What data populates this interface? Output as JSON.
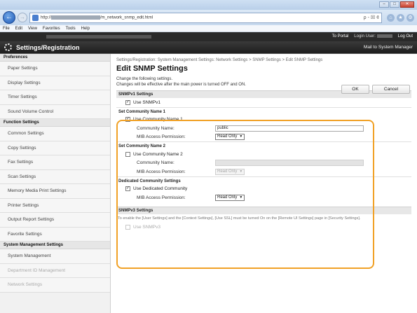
{
  "browser": {
    "url_prefix": "http://",
    "url_suffix": "/m_network_snmp_edit.html",
    "url_tools": "ρ - ☒ ¢",
    "menu": [
      "File",
      "Edit",
      "View",
      "Favorites",
      "Tools",
      "Help"
    ]
  },
  "header": {
    "to_portal": "To Portal",
    "login_user": "Login User:",
    "logout": "Log Out",
    "app_title": "Settings/Registration",
    "mail": "Mail to System Manager"
  },
  "sidebar": {
    "sections": [
      {
        "title": "Preferences",
        "items": [
          "Paper Settings",
          "Display Settings",
          "Timer Settings",
          "Sound Volume Control"
        ]
      },
      {
        "title": "Function Settings",
        "items": [
          "Common Settings",
          "Copy Settings",
          "Fax Settings",
          "Scan Settings",
          "Memory Media Print Settings",
          "Printer Settings",
          "Output Report Settings",
          "Favorite Settings"
        ]
      },
      {
        "title": "System Management Settings",
        "items": [
          "System Management",
          "Department ID Management",
          "Network Settings"
        ]
      }
    ]
  },
  "main": {
    "breadcrumb": "Settings/Registration: System Management Settings: Network Settings > SNMP Settings > Edit SNMP Settings",
    "title": "Edit SNMP Settings",
    "intro1": "Change the following settings.",
    "intro2": "Changes will be effective after the main power is turned OFF and ON.",
    "ok": "OK",
    "cancel": "Cancel",
    "snmpv1_head": "SNMPv1 Settings",
    "use_snmpv1": "Use SNMPv1",
    "set1_head": "Set Community Name 1",
    "use_c1": "Use Community Name 1",
    "community_name_label": "Community Name:",
    "community_name_value": "public",
    "mib_label": "MIB Access Permission:",
    "read_only": "Read Only",
    "set2_head": "Set Community Name 2",
    "use_c2": "Use Community Name 2",
    "dedicated_head": "Dedicated Community Settings",
    "use_dedicated": "Use Dedicated Community",
    "snmpv3_head": "SNMPv3 Settings",
    "snmpv3_note": "To enable the [User Settings] and the [Context Settings], [Use SSL] must be turned On on the [Remote UI Settings] page in [Security Settings].",
    "use_snmpv3": "Use SNMPv3"
  }
}
